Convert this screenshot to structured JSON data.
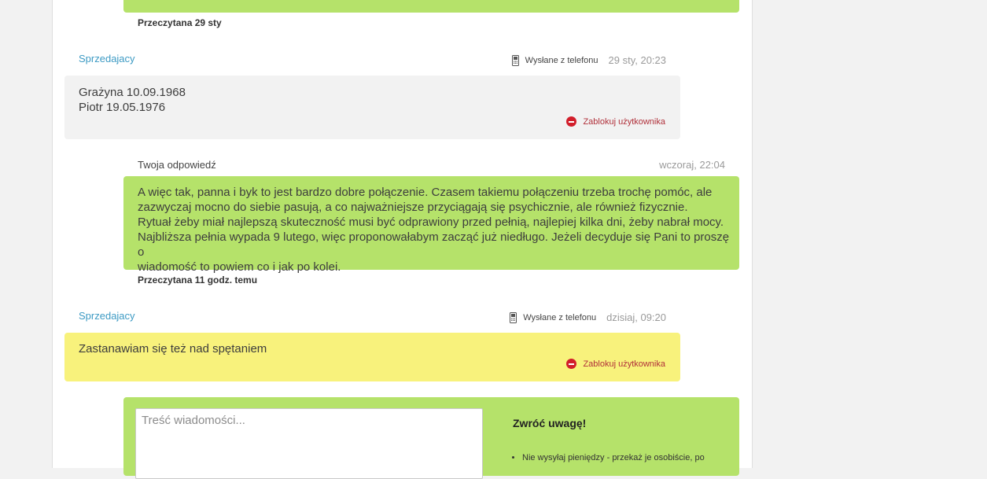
{
  "conversation": {
    "top_read_status": "Przeczytana 29 sty",
    "messages": [
      {
        "sender": "Sprzedajacy",
        "sent_via": "Wysłane z telefonu",
        "time": "29 sty, 20:23",
        "text": "Grażyna 10.09.1968\nPiotr 19.05.1976",
        "block_label": "Zablokuj użytkownika"
      },
      {
        "label": "Twoja odpowiedź",
        "time": "wczoraj, 22:04",
        "text": "A więc tak, panna i byk to jest bardzo dobre połączenie. Czasem takiemu połączeniu trzeba trochę pomóc, ale\nzazwyczaj mocno do siebie pasują, a co najważniejsze przyciągają się psychicznie, ale również fizycznie.\nRytuał żeby miał najlepszą skuteczność musi być odprawiony przed pełnią, najlepiej kilka dni, żeby nabrał mocy.\nNajbliższa pełnia wypada 9 lutego, więc proponowałabym zacząć już niedługo. Jeżeli decyduje się Pani to proszę o\nwiadomość to powiem co i jak po kolei.",
        "read_status": "Przeczytana 11 godz. temu"
      },
      {
        "sender": "Sprzedajacy",
        "sent_via": "Wysłane z telefonu",
        "time": "dzisiaj, 09:20",
        "text": "Zastanawiam się też nad spętaniem",
        "block_label": "Zablokuj użytkownika"
      }
    ]
  },
  "compose": {
    "placeholder": "Treść wiadomości...",
    "notice_title": "Zwróć uwagę!",
    "notice_items": [
      "Nie wysyłaj pieniędzy - przekaż je osobiście, po"
    ]
  },
  "colors": {
    "outgoing_bubble": "#b5e26a",
    "incoming_bubble": "#f2f2f2",
    "unread_bubble": "#f8f27c",
    "seller_link": "#3e9bc4",
    "block_red": "#d21e2b"
  },
  "icons": {
    "sent_via": "mobile-phone-icon",
    "block": "no-entry-icon"
  }
}
